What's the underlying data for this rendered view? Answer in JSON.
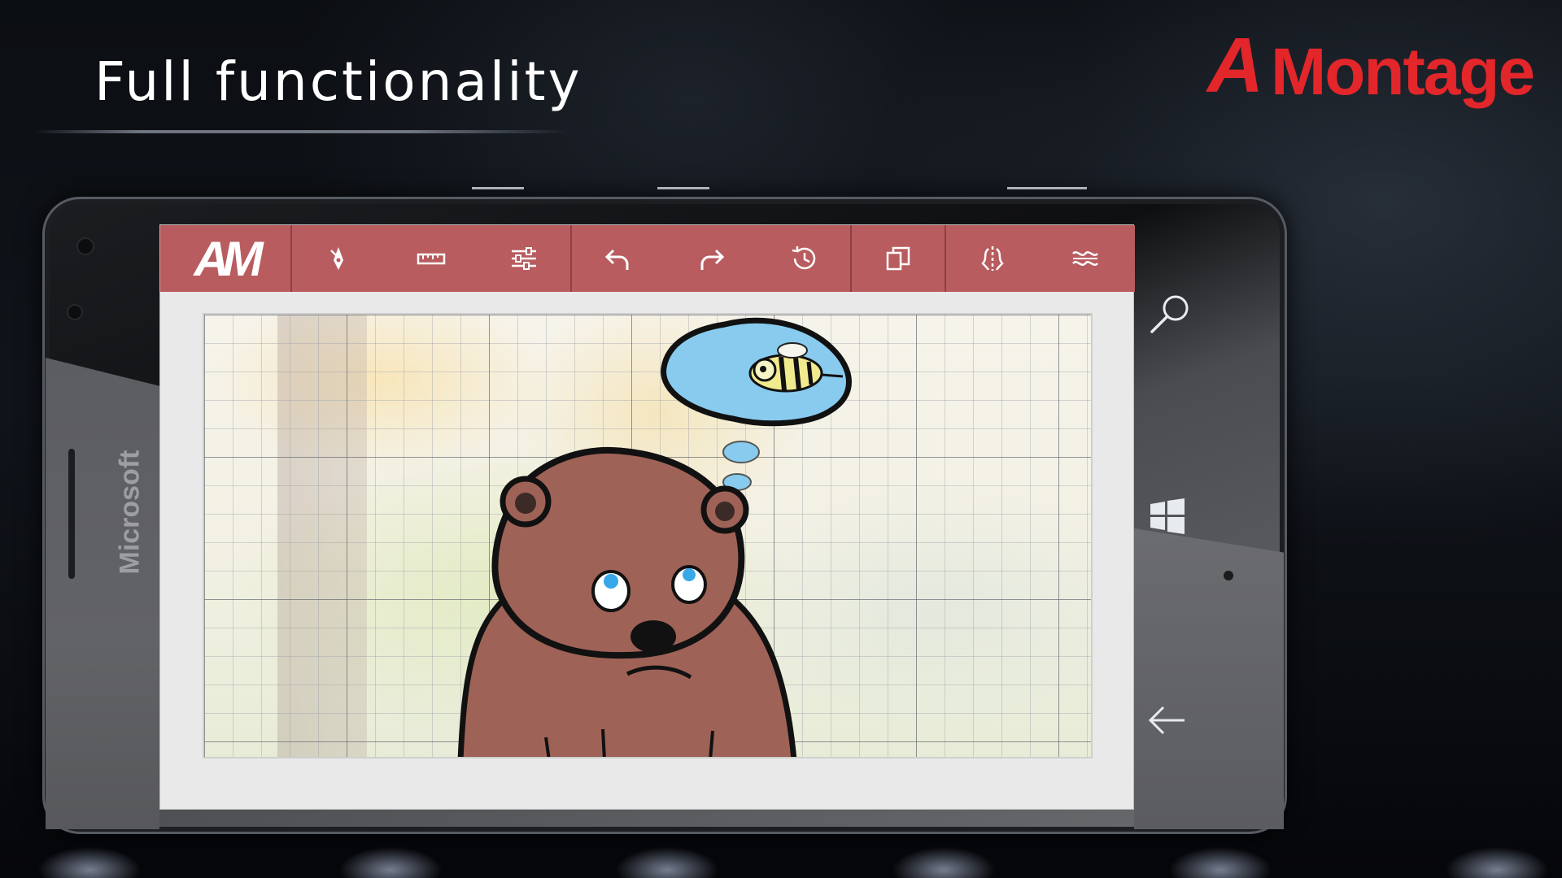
{
  "headline": "Full functionality",
  "brand": {
    "logo_initial": "A",
    "logo_word": "Montage",
    "logo_color": "#e3262a"
  },
  "device": {
    "manufacturer_label": "Microsoft",
    "buttons": [
      "search-icon",
      "windows-start-icon",
      "back-arrow-icon"
    ]
  },
  "app": {
    "logo_label": "AM",
    "toolbar_color": "#b85c5f",
    "toolbar_icons": [
      "pen-nib-icon",
      "ruler-icon",
      "sliders-icon",
      "undo-icon",
      "redo-icon",
      "history-icon",
      "copy-pages-icon",
      "mirror-icon",
      "wave-icon"
    ]
  },
  "canvas": {
    "grid": true,
    "drawing": "bear-thinking-about-bee"
  }
}
